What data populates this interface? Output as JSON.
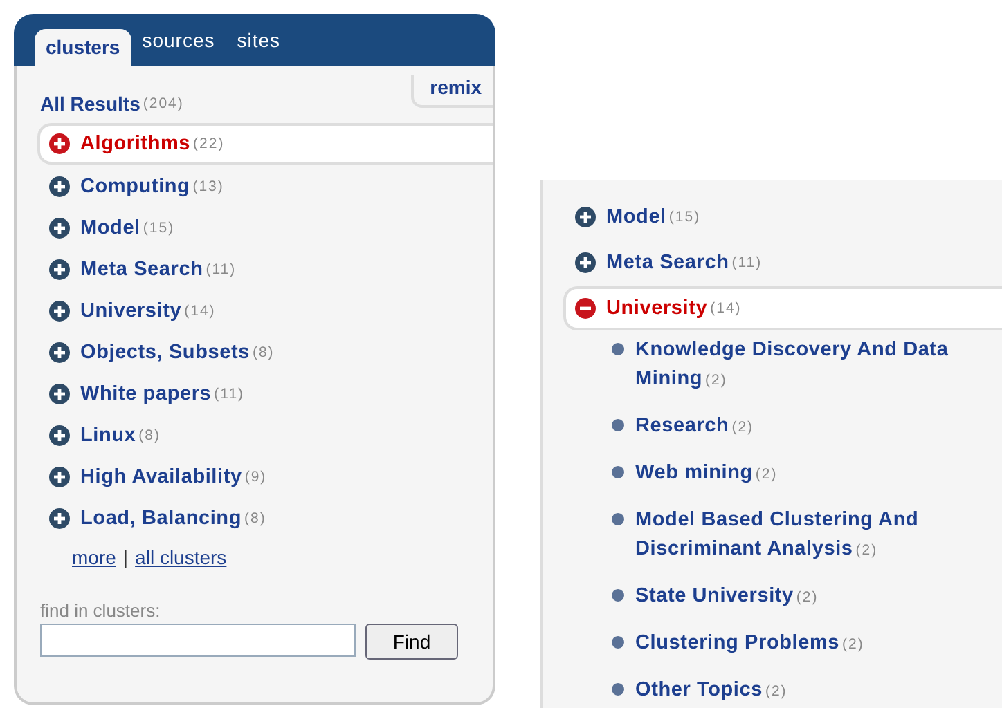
{
  "left_panel": {
    "tabs": [
      {
        "label": "clusters",
        "selected": true
      },
      {
        "label": "sources",
        "selected": false
      },
      {
        "label": "sites",
        "selected": false
      }
    ],
    "remix": "remix",
    "all_results": {
      "label": "All Results",
      "count": "(204)"
    },
    "clusters": [
      {
        "label": "Algorithms",
        "count": "(22)",
        "selected": true,
        "expanded": false
      },
      {
        "label": "Computing",
        "count": "(13)",
        "selected": false,
        "expanded": false
      },
      {
        "label": "Model",
        "count": "(15)",
        "selected": false,
        "expanded": false
      },
      {
        "label": "Meta Search",
        "count": "(11)",
        "selected": false,
        "expanded": false
      },
      {
        "label": "University",
        "count": "(14)",
        "selected": false,
        "expanded": false
      },
      {
        "label": "Objects, Subsets",
        "count": "(8)",
        "selected": false,
        "expanded": false
      },
      {
        "label": "White papers",
        "count": "(11)",
        "selected": false,
        "expanded": false
      },
      {
        "label": "Linux",
        "count": "(8)",
        "selected": false,
        "expanded": false
      },
      {
        "label": "High Availability",
        "count": "(9)",
        "selected": false,
        "expanded": false
      },
      {
        "label": "Load, Balancing",
        "count": "(8)",
        "selected": false,
        "expanded": false
      }
    ],
    "links": [
      "more",
      "all clusters"
    ],
    "separator": "|",
    "find_label": "find in clusters:",
    "find_button": "Find"
  },
  "right_panel": {
    "clusters": [
      {
        "label": "Model",
        "count": "(15)",
        "selected": false,
        "expanded": false
      },
      {
        "label": "Meta Search",
        "count": "(11)",
        "selected": false,
        "expanded": false
      },
      {
        "label": "University",
        "count": "(14)",
        "selected": true,
        "expanded": true,
        "children": [
          {
            "label": "Knowledge Discovery And Data Mining",
            "count": "(2)"
          },
          {
            "label": "Research",
            "count": "(2)"
          },
          {
            "label": "Web mining",
            "count": "(2)"
          },
          {
            "label": "Model Based Clustering And Discriminant Analysis",
            "count": "(2)"
          },
          {
            "label": "State University",
            "count": "(2)"
          },
          {
            "label": "Clustering Problems",
            "count": "(2)"
          },
          {
            "label": "Other Topics",
            "count": "(2)"
          }
        ]
      }
    ]
  }
}
